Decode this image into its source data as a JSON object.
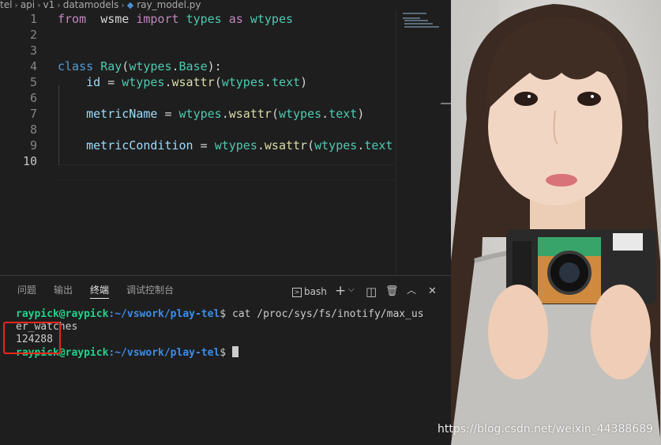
{
  "breadcrumb": [
    "tel",
    "api",
    "v1",
    "datamodels",
    "ray_model.py"
  ],
  "code_lines": [
    {
      "num": "1",
      "tokens": [
        [
          "kw",
          "from"
        ],
        [
          "",
          "  "
        ],
        [
          "",
          "wsme"
        ],
        [
          "",
          " "
        ],
        [
          "kw",
          "import"
        ],
        [
          "",
          " "
        ],
        [
          "cls",
          "types"
        ],
        [
          "",
          " "
        ],
        [
          "kw",
          "as"
        ],
        [
          "",
          " "
        ],
        [
          "cls",
          "wtypes"
        ]
      ]
    },
    {
      "num": "2",
      "tokens": []
    },
    {
      "num": "3",
      "tokens": []
    },
    {
      "num": "4",
      "tokens": [
        [
          "kwb",
          "class"
        ],
        [
          "",
          " "
        ],
        [
          "cls",
          "Ray"
        ],
        [
          "",
          "("
        ],
        [
          "cls",
          "wtypes"
        ],
        [
          "",
          "."
        ],
        [
          "cls",
          "Base"
        ],
        [
          "",
          "):"
        ]
      ]
    },
    {
      "num": "5",
      "tokens": [
        [
          "",
          "    "
        ],
        [
          "var",
          "id"
        ],
        [
          "",
          " = "
        ],
        [
          "cls",
          "wtypes"
        ],
        [
          "",
          "."
        ],
        [
          "fn",
          "wsattr"
        ],
        [
          "",
          "("
        ],
        [
          "cls",
          "wtypes"
        ],
        [
          "",
          "."
        ],
        [
          "cls",
          "text"
        ],
        [
          "",
          ")"
        ]
      ]
    },
    {
      "num": "6",
      "tokens": []
    },
    {
      "num": "7",
      "tokens": [
        [
          "",
          "    "
        ],
        [
          "var",
          "metricName"
        ],
        [
          "",
          " = "
        ],
        [
          "cls",
          "wtypes"
        ],
        [
          "",
          "."
        ],
        [
          "fn",
          "wsattr"
        ],
        [
          "",
          "("
        ],
        [
          "cls",
          "wtypes"
        ],
        [
          "",
          "."
        ],
        [
          "cls",
          "text"
        ],
        [
          "",
          ")"
        ]
      ]
    },
    {
      "num": "8",
      "tokens": []
    },
    {
      "num": "9",
      "tokens": [
        [
          "",
          "    "
        ],
        [
          "var",
          "metricCondition"
        ],
        [
          "",
          " = "
        ],
        [
          "cls",
          "wtypes"
        ],
        [
          "",
          "."
        ],
        [
          "fn",
          "wsattr"
        ],
        [
          "",
          "("
        ],
        [
          "cls",
          "wtypes"
        ],
        [
          "",
          "."
        ],
        [
          "cls",
          "text"
        ]
      ]
    },
    {
      "num": "10",
      "tokens": []
    }
  ],
  "panel": {
    "tabs": [
      "问题",
      "输出",
      "终端",
      "调试控制台"
    ],
    "active_tab": "终端",
    "shell": "bash",
    "add_symbol": "+",
    "chevron": "⌵",
    "split_symbol": "◫",
    "trash_symbol": "🗑",
    "up_symbol": "︿",
    "close_symbol": "✕"
  },
  "terminal": {
    "user_host": "raypick@raypick",
    "path": ":~/vswork/play-tel",
    "prompt": "$",
    "command_part1": " cat /proc/sys/fs/inotify/max_us",
    "command_part2": "er_watches",
    "output": "124288"
  },
  "watermark": "https://blog.csdn.net/weixin_44388689",
  "colors": {
    "accent_highlight": "#e8261c",
    "user": "#23d18b",
    "path": "#3b8eea"
  }
}
